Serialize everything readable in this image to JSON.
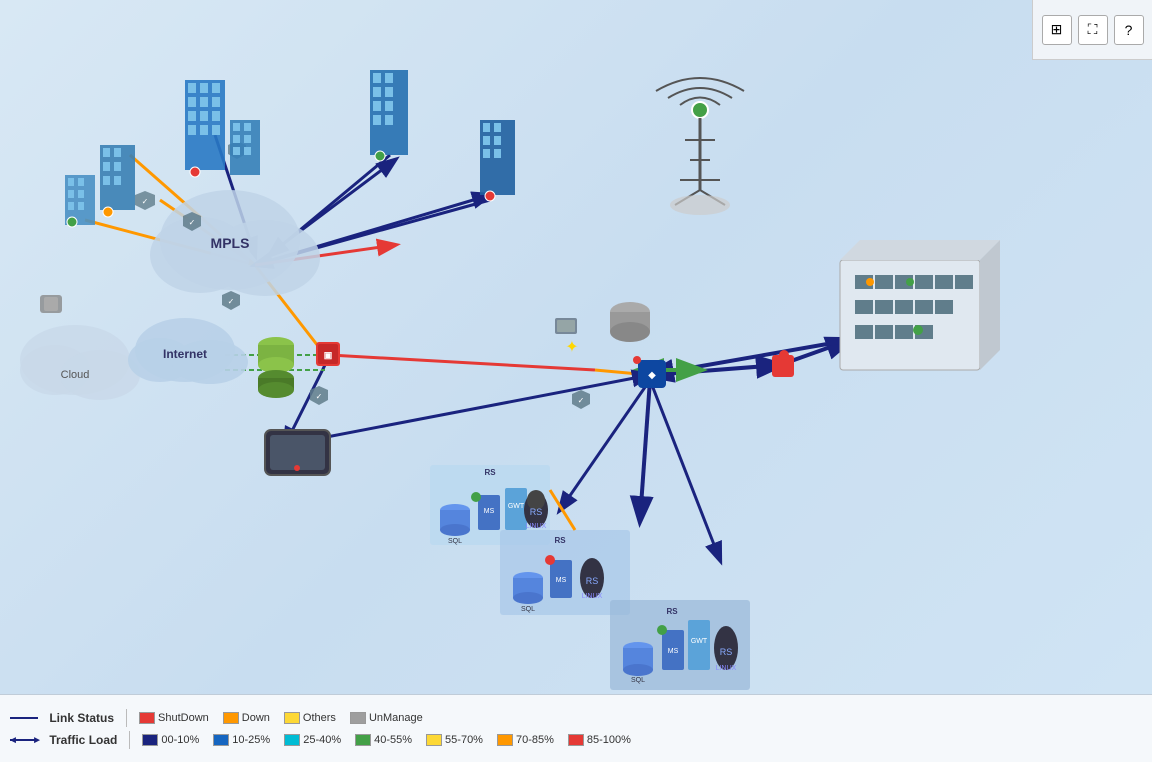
{
  "toolbar": {
    "buttons": [
      {
        "id": "toggle-icon",
        "label": "⊞",
        "title": "Toggle"
      },
      {
        "id": "expand-icon",
        "label": "⛶",
        "title": "Expand"
      },
      {
        "id": "help-icon",
        "label": "?",
        "title": "Help"
      }
    ]
  },
  "legend": {
    "link_status_label": "Link Status",
    "traffic_load_label": "Traffic Load",
    "status_items": [
      {
        "label": "ShutDown",
        "color": "#e53935"
      },
      {
        "label": "Down",
        "color": "#ff9800"
      },
      {
        "label": "Others",
        "color": "#fdd835"
      },
      {
        "label": "UnManage",
        "color": "#9e9e9e"
      }
    ],
    "traffic_items": [
      {
        "label": "00-10%",
        "color": "#1a237e"
      },
      {
        "label": "10-25%",
        "color": "#1565c0"
      },
      {
        "label": "25-40%",
        "color": "#00bcd4"
      },
      {
        "label": "40-55%",
        "color": "#43a047"
      },
      {
        "label": "55-70%",
        "color": "#fdd835"
      },
      {
        "label": "70-85%",
        "color": "#ff9800"
      },
      {
        "label": "85-100%",
        "color": "#e53935"
      }
    ]
  }
}
